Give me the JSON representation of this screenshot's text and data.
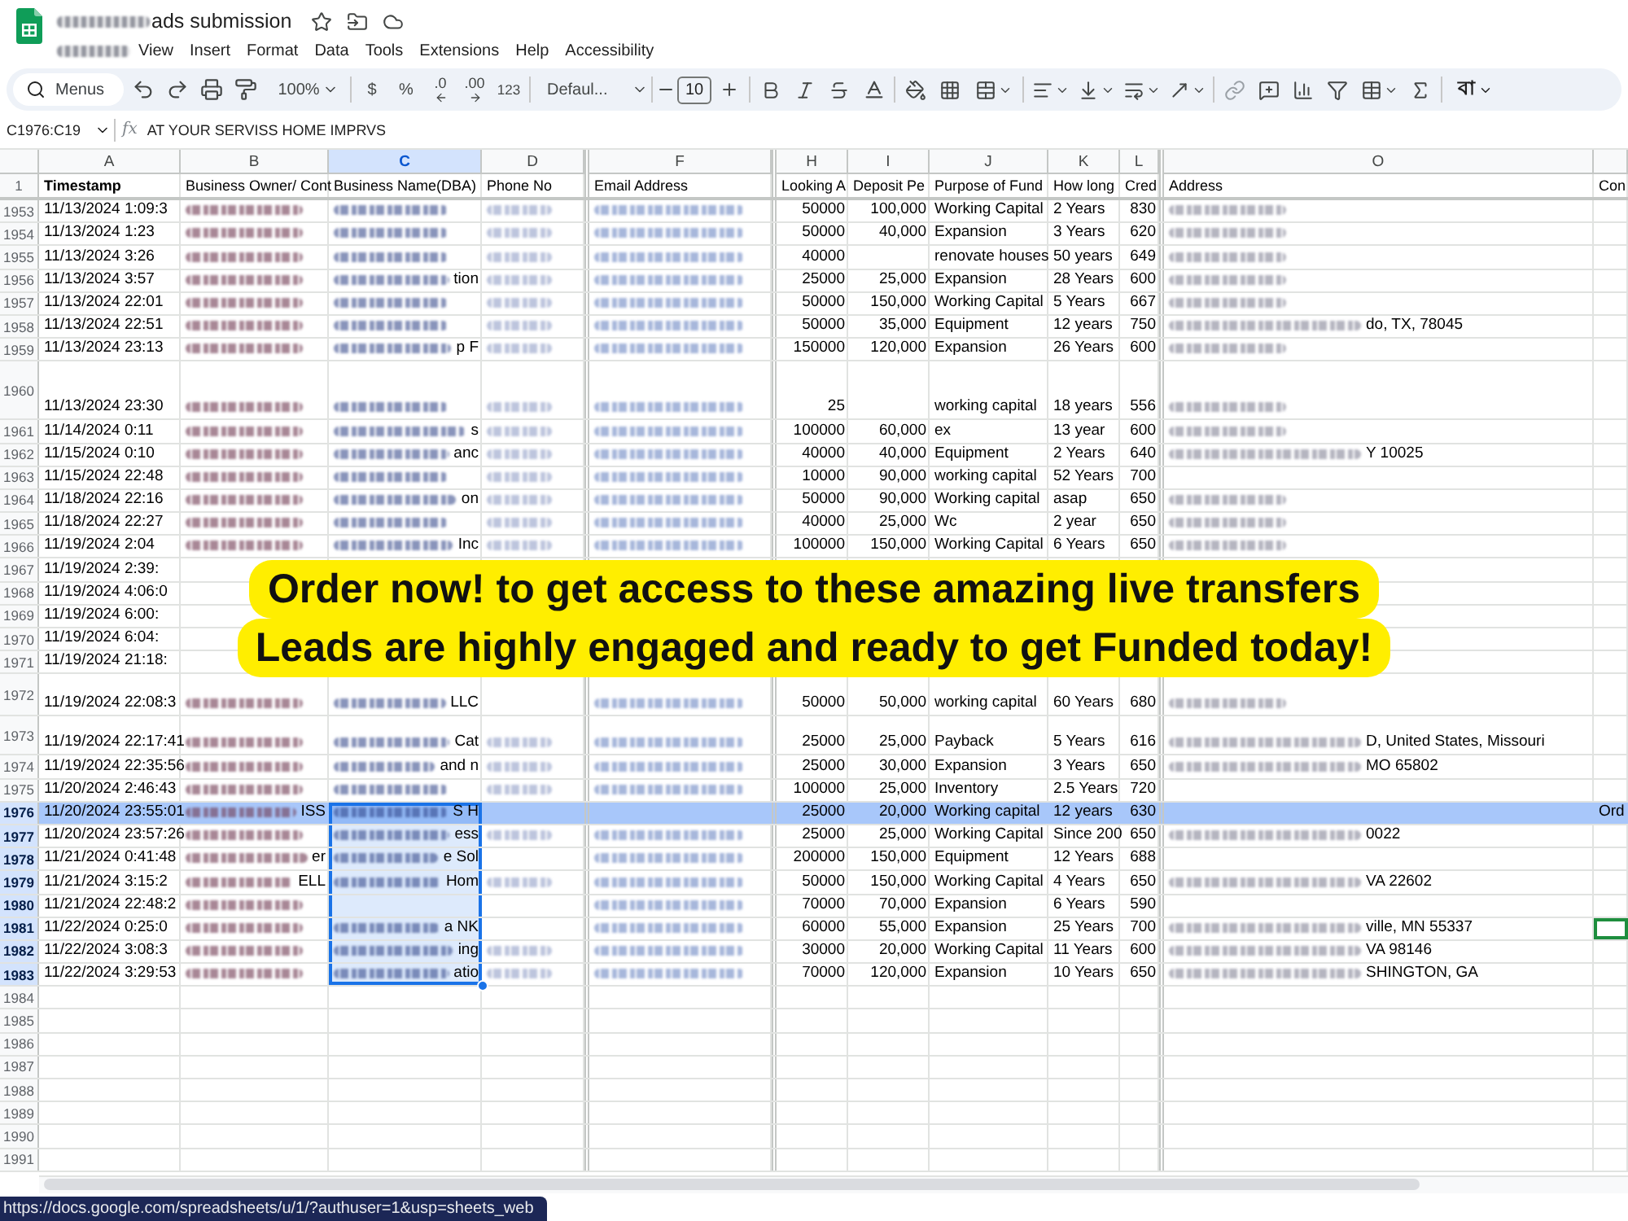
{
  "document": {
    "title": {
      "redacted": true,
      "text": "ads submission"
    },
    "menus": [
      {
        "redacted": true
      },
      {
        "label": "View"
      },
      {
        "label": "Insert"
      },
      {
        "label": "Format"
      },
      {
        "label": "Data"
      },
      {
        "label": "Tools"
      },
      {
        "label": "Extensions"
      },
      {
        "label": "Help"
      },
      {
        "label": "Accessibility"
      }
    ]
  },
  "toolbar": {
    "search": {
      "placeholder": "Menus"
    },
    "zoom": "100%",
    "number_formats": [
      "$",
      "%",
      ".0",
      ".00",
      "123"
    ],
    "font": "Defaul...",
    "font_size": "10",
    "input_tool": "বা"
  },
  "formula_bar": {
    "name_box": "C1976:C19",
    "function_symbol": "fx",
    "formula": "AT YOUR SERVISS HOME IMPRVS"
  },
  "grid": {
    "columns": [
      {
        "letter": "A",
        "heading": "Timestamp",
        "selected": false
      },
      {
        "letter": "B",
        "heading": "Business Owner/ Cont",
        "selected": false
      },
      {
        "letter": "C",
        "heading": "Business Name(DBA)",
        "selected": true
      },
      {
        "letter": "D",
        "heading": "Phone No",
        "selected": false
      },
      {
        "letter": "F",
        "heading": "Email Address",
        "selected": false
      },
      {
        "letter": "H",
        "heading": "Looking A",
        "selected": false
      },
      {
        "letter": "I",
        "heading": "Deposit Pe",
        "selected": false
      },
      {
        "letter": "J",
        "heading": "Purpose of Fund",
        "selected": false
      },
      {
        "letter": "K",
        "heading": "How long",
        "selected": false
      },
      {
        "letter": "L",
        "heading": "Cred",
        "selected": false
      },
      {
        "letter": "O",
        "heading": "Address",
        "selected": false
      },
      {
        "heading": "Con",
        "selected": false
      }
    ],
    "header_row": {
      "num": "1"
    },
    "rows": [
      {
        "num": "1953",
        "selected": false,
        "highlighted": false,
        "cursor": false,
        "cells": [
          "11/13/2024 1:09:3",
          {
            "redacted": true
          },
          {
            "redacted": true
          },
          {
            "redacted": true
          },
          {
            "redacted": true
          },
          "50000",
          "100,000",
          "Working Capital",
          "2 Years",
          "830",
          {
            "redacted": true
          },
          null
        ]
      },
      {
        "num": "1954",
        "selected": false,
        "highlighted": false,
        "cursor": false,
        "cells": [
          "11/13/2024 1:23",
          {
            "redacted": true
          },
          {
            "redacted": true
          },
          {
            "redacted": true
          },
          {
            "redacted": true
          },
          "50000",
          "40,000",
          "Expansion",
          "3 Years",
          "620",
          {
            "redacted": true
          },
          null
        ]
      },
      {
        "num": "1955",
        "selected": false,
        "highlighted": false,
        "cursor": false,
        "cells": [
          "11/13/2024 3:26",
          {
            "redacted": true
          },
          {
            "redacted": true
          },
          {
            "redacted": true
          },
          {
            "redacted": true
          },
          "40000",
          null,
          "renovate houses",
          "50 years",
          "649",
          {
            "redacted": true
          },
          null
        ]
      },
      {
        "num": "1956",
        "selected": false,
        "highlighted": false,
        "cursor": false,
        "cells": [
          "11/13/2024 3:57",
          {
            "redacted": true
          },
          {
            "redacted": true,
            "text": "tion"
          },
          {
            "redacted": true
          },
          {
            "redacted": true
          },
          "25000",
          "25,000",
          "Expansion",
          "28 Years",
          "600",
          {
            "redacted": true
          },
          null
        ]
      },
      {
        "num": "1957",
        "selected": false,
        "highlighted": false,
        "cursor": false,
        "cells": [
          "11/13/2024 22:01",
          {
            "redacted": true
          },
          {
            "redacted": true
          },
          {
            "redacted": true
          },
          {
            "redacted": true
          },
          "50000",
          "150,000",
          "Working Capital",
          "5 Years",
          "667",
          {
            "redacted": true
          },
          null
        ]
      },
      {
        "num": "1958",
        "selected": false,
        "highlighted": false,
        "cursor": false,
        "cells": [
          "11/13/2024 22:51",
          {
            "redacted": true
          },
          {
            "redacted": true
          },
          {
            "redacted": true
          },
          {
            "redacted": true
          },
          "50000",
          "35,000",
          "Equipment",
          "12 years",
          "750",
          {
            "redacted": true,
            "text": "do, TX, 78045"
          },
          null
        ]
      },
      {
        "num": "1959",
        "selected": false,
        "highlighted": false,
        "cursor": false,
        "cells": [
          "11/13/2024 23:13",
          {
            "redacted": true
          },
          {
            "redacted": true,
            "text": "p F"
          },
          {
            "redacted": true
          },
          {
            "redacted": true
          },
          "150000",
          "120,000",
          "Expansion",
          "26 Years",
          "600",
          {
            "redacted": true
          },
          null
        ]
      },
      {
        "num": "1960",
        "selected": false,
        "highlighted": false,
        "cursor": false,
        "cells": [
          "11/13/2024 23:30",
          {
            "redacted": true
          },
          {
            "redacted": true
          },
          {
            "redacted": true
          },
          {
            "redacted": true
          },
          "25",
          null,
          "working capital",
          "18 years",
          "556",
          {
            "redacted": true
          },
          null
        ]
      },
      {
        "num": "1961",
        "selected": false,
        "highlighted": false,
        "cursor": false,
        "cells": [
          "11/14/2024 0:11",
          {
            "redacted": true
          },
          {
            "redacted": true,
            "text": "s"
          },
          {
            "redacted": true
          },
          {
            "redacted": true
          },
          "100000",
          "60,000",
          "ex",
          "13 year",
          "600",
          {
            "redacted": true
          },
          null
        ]
      },
      {
        "num": "1962",
        "selected": false,
        "highlighted": false,
        "cursor": false,
        "cells": [
          "11/15/2024 0:10",
          {
            "redacted": true
          },
          {
            "redacted": true,
            "text": "anc"
          },
          {
            "redacted": true
          },
          {
            "redacted": true
          },
          "40000",
          "40,000",
          "Equipment",
          "2 Years",
          "640",
          {
            "redacted": true,
            "text": "Y 10025"
          },
          null
        ]
      },
      {
        "num": "1963",
        "selected": false,
        "highlighted": false,
        "cursor": false,
        "cells": [
          "11/15/2024 22:48",
          {
            "redacted": true
          },
          {
            "redacted": true
          },
          {
            "redacted": true
          },
          {
            "redacted": true
          },
          "10000",
          "90,000",
          "working capital",
          "52 Years",
          "700",
          null,
          null
        ]
      },
      {
        "num": "1964",
        "selected": false,
        "highlighted": false,
        "cursor": false,
        "cells": [
          "11/18/2024 22:16",
          {
            "redacted": true
          },
          {
            "redacted": true,
            "text": "on"
          },
          {
            "redacted": true
          },
          {
            "redacted": true
          },
          "50000",
          "90,000",
          "Working capital",
          "asap",
          "650",
          {
            "redacted": true
          },
          null
        ]
      },
      {
        "num": "1965",
        "selected": false,
        "highlighted": false,
        "cursor": false,
        "cells": [
          "11/18/2024 22:27",
          {
            "redacted": true
          },
          {
            "redacted": true
          },
          {
            "redacted": true
          },
          {
            "redacted": true
          },
          "40000",
          "25,000",
          "Wc",
          "2 year",
          "650",
          {
            "redacted": true
          },
          null
        ]
      },
      {
        "num": "1966",
        "selected": false,
        "highlighted": false,
        "cursor": false,
        "cells": [
          "11/19/2024 2:04",
          {
            "redacted": true
          },
          {
            "redacted": true,
            "text": "Inc"
          },
          {
            "redacted": true
          },
          {
            "redacted": true
          },
          "100000",
          "150,000",
          "Working Capital",
          "6 Years",
          "650",
          {
            "redacted": true
          },
          null
        ]
      },
      {
        "num": "1967",
        "selected": false,
        "highlighted": false,
        "cursor": false,
        "cells": [
          "11/19/2024 2:39:"
        ]
      },
      {
        "num": "1968",
        "selected": false,
        "highlighted": false,
        "cursor": false,
        "cells": [
          "11/19/2024 4:06:0"
        ]
      },
      {
        "num": "1969",
        "selected": false,
        "highlighted": false,
        "cursor": false,
        "cells": [
          "11/19/2024 6:00:"
        ]
      },
      {
        "num": "1970",
        "selected": false,
        "highlighted": false,
        "cursor": false,
        "cells": [
          "11/19/2024 6:04:"
        ]
      },
      {
        "num": "1971",
        "selected": false,
        "highlighted": false,
        "cursor": false,
        "cells": [
          "11/19/2024 21:18:"
        ]
      },
      {
        "num": "1972",
        "selected": false,
        "highlighted": false,
        "cursor": false,
        "cells": [
          "11/19/2024 22:08:3",
          {
            "redacted": true
          },
          {
            "redacted": true,
            "text": "LLC"
          },
          null,
          {
            "redacted": true
          },
          "50000",
          "50,000",
          "working capital",
          "60 Years",
          "680",
          {
            "redacted": true
          },
          null
        ]
      },
      {
        "num": "1973",
        "selected": false,
        "highlighted": false,
        "cursor": false,
        "cells": [
          "11/19/2024 22:17:41",
          {
            "redacted": true
          },
          {
            "redacted": true,
            "text": "Cat"
          },
          {
            "redacted": true
          },
          {
            "redacted": true
          },
          "25000",
          "25,000",
          "Payback",
          "5 Years",
          "616",
          {
            "redacted": true,
            "text": "D, United States, Missouri"
          },
          null
        ]
      },
      {
        "num": "1974",
        "selected": false,
        "highlighted": false,
        "cursor": false,
        "cells": [
          "11/19/2024 22:35:56",
          {
            "redacted": true
          },
          {
            "redacted": true,
            "text": "and n"
          },
          {
            "redacted": true
          },
          {
            "redacted": true
          },
          "25000",
          "30,000",
          "Expansion",
          "3 Years",
          "650",
          {
            "redacted": true,
            "text": "MO 65802"
          },
          null
        ]
      },
      {
        "num": "1975",
        "selected": false,
        "highlighted": false,
        "cursor": false,
        "cells": [
          "11/20/2024 2:46:43",
          {
            "redacted": true
          },
          {
            "redacted": true
          },
          {
            "redacted": true
          },
          {
            "redacted": true
          },
          "100000",
          "25,000",
          "Inventory",
          "2.5 Years",
          "720",
          null,
          null
        ]
      },
      {
        "num": "1976",
        "selected": true,
        "highlighted": true,
        "cursor": false,
        "cells": [
          "11/20/2024 23:55:01",
          {
            "redacted": true,
            "text": "ISS"
          },
          {
            "redacted": true,
            "text": "S H"
          },
          null,
          null,
          "25000",
          "20,000",
          "Working capital",
          "12 years",
          "630",
          null,
          "Ord"
        ]
      },
      {
        "num": "1977",
        "selected": true,
        "highlighted": false,
        "cursor": false,
        "cells": [
          "11/20/2024 23:57:26",
          {
            "redacted": true
          },
          {
            "redacted": true,
            "text": "ess"
          },
          {
            "redacted": true
          },
          {
            "redacted": true
          },
          "25000",
          "25,000",
          "Working Capital",
          "Since 200",
          "650",
          {
            "redacted": true,
            "text": "0022"
          },
          null
        ]
      },
      {
        "num": "1978",
        "selected": true,
        "highlighted": false,
        "cursor": false,
        "cells": [
          "11/21/2024 0:41:48",
          {
            "redacted": true,
            "text": "er"
          },
          {
            "redacted": true,
            "text": "e Sol"
          },
          null,
          {
            "redacted": true
          },
          "200000",
          "150,000",
          "Equipment",
          "12 Years",
          "688",
          null,
          null
        ]
      },
      {
        "num": "1979",
        "selected": true,
        "highlighted": false,
        "cursor": false,
        "cells": [
          "11/21/2024 3:15:2",
          {
            "redacted": true,
            "text": "ELL"
          },
          {
            "redacted": true,
            "text": "Hom"
          },
          {
            "redacted": true
          },
          {
            "redacted": true
          },
          "50000",
          "150,000",
          "Working Capital",
          "4 Years",
          "650",
          {
            "redacted": true,
            "text": "VA 22602"
          },
          null
        ]
      },
      {
        "num": "1980",
        "selected": true,
        "highlighted": false,
        "cursor": false,
        "cells": [
          "11/21/2024 22:48:2",
          {
            "redacted": true
          },
          null,
          null,
          {
            "redacted": true
          },
          "70000",
          "70,000",
          "Expansion",
          "6 Years",
          "590",
          null,
          null
        ]
      },
      {
        "num": "1981",
        "selected": true,
        "highlighted": false,
        "cursor": true,
        "cells": [
          "11/22/2024 0:25:0",
          {
            "redacted": true
          },
          {
            "redacted": true,
            "text": "a NK"
          },
          null,
          {
            "redacted": true
          },
          "60000",
          "55,000",
          "Expansion",
          "25 Years",
          "700",
          {
            "redacted": true,
            "text": "ville, MN 55337"
          },
          null
        ]
      },
      {
        "num": "1982",
        "selected": true,
        "highlighted": false,
        "cursor": false,
        "cells": [
          "11/22/2024 3:08:3",
          {
            "redacted": true
          },
          {
            "redacted": true,
            "text": "ing"
          },
          {
            "redacted": true
          },
          {
            "redacted": true
          },
          "30000",
          "20,000",
          "Working Capital",
          "11 Years",
          "600",
          {
            "redacted": true,
            "text": "VA 98146"
          },
          null
        ]
      },
      {
        "num": "1983",
        "selected": true,
        "highlighted": false,
        "cursor": false,
        "cells": [
          "11/22/2024 3:29:53",
          {
            "redacted": true
          },
          {
            "redacted": true,
            "text": "atio"
          },
          {
            "redacted": true
          },
          {
            "redacted": true
          },
          "70000",
          "120,000",
          "Expansion",
          "10 Years",
          "650",
          {
            "redacted": true,
            "text": "SHINGTON, GA"
          },
          null
        ]
      },
      {
        "num": "1984",
        "selected": false,
        "highlighted": false,
        "cursor": false
      },
      {
        "num": "1985",
        "selected": false,
        "highlighted": false,
        "cursor": false
      },
      {
        "num": "1986",
        "selected": false,
        "highlighted": false,
        "cursor": false
      },
      {
        "num": "1987",
        "selected": false,
        "highlighted": false,
        "cursor": false
      },
      {
        "num": "1988",
        "selected": false,
        "highlighted": false,
        "cursor": false
      },
      {
        "num": "1989",
        "selected": false,
        "highlighted": false,
        "cursor": false
      },
      {
        "num": "1990",
        "selected": false,
        "highlighted": false,
        "cursor": false
      },
      {
        "num": "1991",
        "selected": false,
        "highlighted": false,
        "cursor": false
      }
    ]
  },
  "promo_banner": {
    "lines": [
      "Order now! to get access to these amazing live transfers",
      "Leads are highly engaged and ready to get Funded today!"
    ]
  },
  "status_url": "https://docs.google.com/spreadsheets/u/1/?authuser=1&usp=sheets_web"
}
